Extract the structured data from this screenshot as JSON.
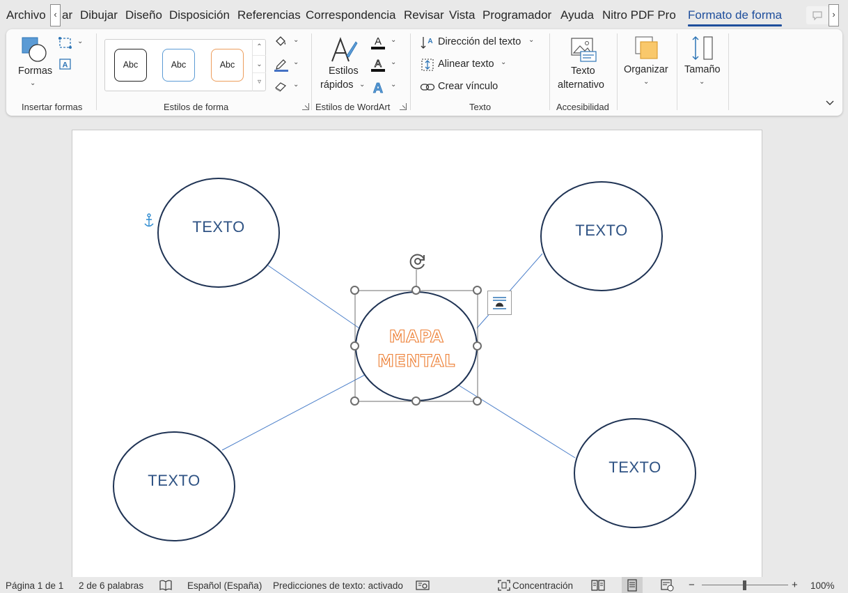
{
  "tabs": [
    "Archivo",
    "ar",
    "Dibujar",
    "Diseño",
    "Disposición",
    "Referencias",
    "Correspondencia",
    "Revisar",
    "Vista",
    "Programador",
    "Ayuda",
    "Nitro PDF Pro",
    "Formato de forma"
  ],
  "active_tab": "Formato de forma",
  "tab_scroll": {
    "left": "‹",
    "right": "›"
  },
  "ribbon": {
    "insert_shapes": {
      "formas_label": "Formas",
      "group_label": "Insertar formas"
    },
    "shape_styles": {
      "samples": [
        "Abc",
        "Abc",
        "Abc"
      ],
      "group_label": "Estilos de forma"
    },
    "wordart": {
      "estilos_line1": "Estilos",
      "estilos_line2": "rápidos",
      "group_label": "Estilos de WordArt"
    },
    "text": {
      "direccion": "Dirección del texto",
      "alinear": "Alinear texto",
      "vinculo": "Crear vínculo",
      "group_label": "Texto"
    },
    "accessibility": {
      "line1": "Texto",
      "line2": "alternativo",
      "group_label": "Accesibilidad"
    },
    "organizar": "Organizar",
    "tamano": "Tamaño"
  },
  "document": {
    "nodes": [
      "TEXTO",
      "TEXTO",
      "TEXTO",
      "TEXTO"
    ],
    "center": {
      "line1": "MAPA",
      "line2": "MENTAL"
    }
  },
  "statusbar": {
    "page": "Página 1 de 1",
    "words": "2 de 6 palabras",
    "language": "Español (España)",
    "predictions": "Predicciones de texto: activado",
    "focus": "Concentración",
    "zoom_minus": "−",
    "zoom_plus": "+",
    "zoom": "100%"
  },
  "colors": {
    "accent": "#1e4e9c",
    "node_outline": "#1f3354",
    "node_text": "#2f5384",
    "center_text": "#ed7d31",
    "connector": "#4a7ec9"
  }
}
